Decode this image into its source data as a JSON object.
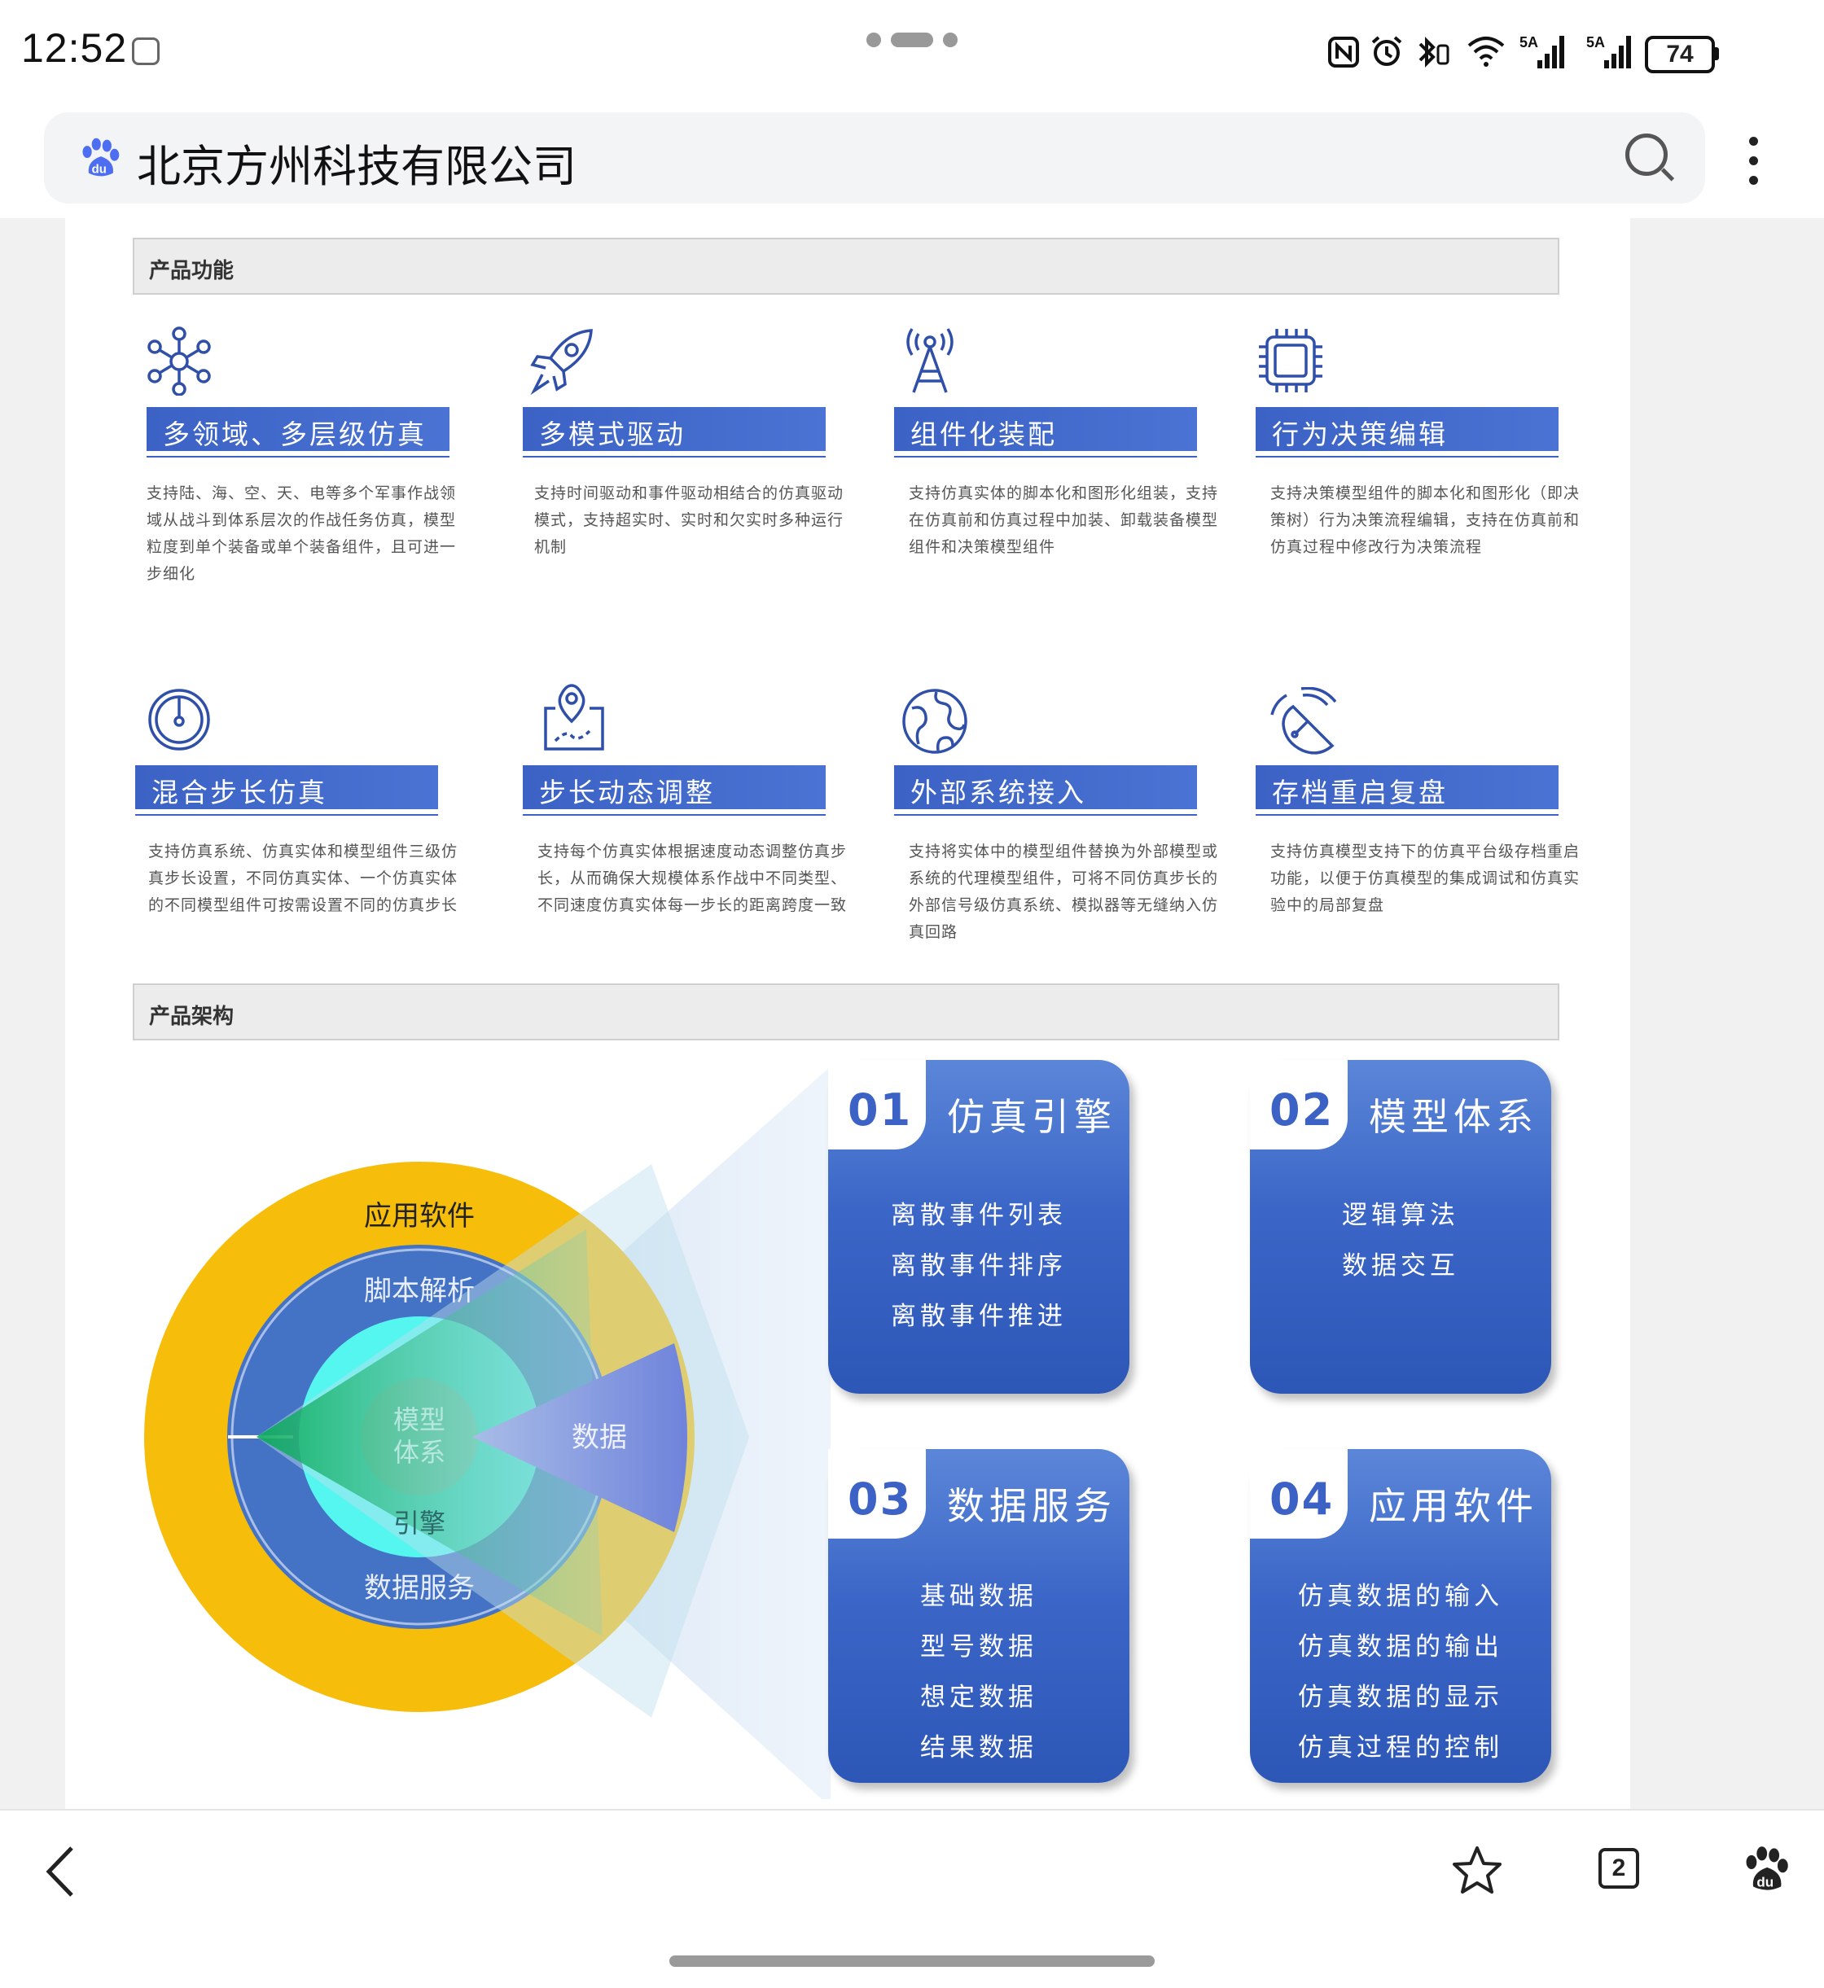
{
  "status_bar": {
    "time": "12:52",
    "battery": "74",
    "icons": [
      "nfc-icon",
      "alarm-icon",
      "bluetooth-icon",
      "wifi-icon",
      "signal-5a-icon",
      "signal-5a-icon"
    ]
  },
  "browser": {
    "title": "北京方州科技有限公司",
    "tab_count": "2"
  },
  "sections": {
    "features_title": "产品功能",
    "architecture_title": "产品架构"
  },
  "features": [
    {
      "title": "多领域、多层级仿真",
      "icon": "network-icon",
      "desc": "支持陆、海、空、天、电等多个军事作战领域从战斗到体系层次的作战任务仿真，模型粒度到单个装备或单个装备组件，且可进一步细化"
    },
    {
      "title": "多模式驱动",
      "icon": "rocket-icon",
      "desc": "支持时间驱动和事件驱动相结合的仿真驱动模式，支持超实时、实时和欠实时多种运行机制"
    },
    {
      "title": "组件化装配",
      "icon": "antenna-icon",
      "desc": "支持仿真实体的脚本化和图形化组装，支持在仿真前和仿真过程中加装、卸载装备模型组件和决策模型组件"
    },
    {
      "title": "行为决策编辑",
      "icon": "chip-icon",
      "desc": "支持决策模型组件的脚本化和图形化（即决策树）行为决策流程编辑，支持在仿真前和仿真过程中修改行为决策流程"
    },
    {
      "title": "混合步长仿真",
      "icon": "timer-icon",
      "desc": "支持仿真系统、仿真实体和模型组件三级仿真步长设置，不同仿真实体、一个仿真实体的不同模型组件可按需设置不同的仿真步长"
    },
    {
      "title": "步长动态调整",
      "icon": "map-pin-icon",
      "desc": "支持每个仿真实体根据速度动态调整仿真步长，从而确保大规模体系作战中不同类型、不同速度仿真实体每一步长的距离跨度一致"
    },
    {
      "title": "外部系统接入",
      "icon": "globe-icon",
      "desc": "支持将实体中的模型组件替换为外部模型或系统的代理模型组件，可将不同仿真步长的外部信号级仿真系统、模拟器等无缝纳入仿真回路"
    },
    {
      "title": "存档重启复盘",
      "icon": "radar-icon",
      "desc": "支持仿真模型支持下的仿真平台级存档重启功能，以便于仿真模型的集成调试和仿真实验中的局部复盘"
    }
  ],
  "diagram": {
    "outer": "应用软件",
    "middle_top": "脚本解析",
    "middle_bottom": "数据服务",
    "inner_bottom": "引擎",
    "core_line1": "模型",
    "core_line2": "体系",
    "wedge": "数据"
  },
  "cards": [
    {
      "num": "01",
      "title": "仿真引擎",
      "items": [
        "离散事件列表",
        "离散事件排序",
        "离散事件推进"
      ]
    },
    {
      "num": "02",
      "title": "模型体系",
      "items": [
        "逻辑算法",
        "数据交互"
      ]
    },
    {
      "num": "03",
      "title": "数据服务",
      "items": [
        "基础数据",
        "型号数据",
        "想定数据",
        "结果数据"
      ]
    },
    {
      "num": "04",
      "title": "应用软件",
      "items": [
        "仿真数据的输入",
        "仿真数据的输出",
        "仿真数据的显示",
        "仿真过程的控制"
      ]
    }
  ],
  "colors": {
    "accent_blue": "#3b62c4",
    "outer_ring": "#f7bd0b",
    "middle_ring": "#4472c4",
    "inner_ring": "#55f5f0"
  }
}
